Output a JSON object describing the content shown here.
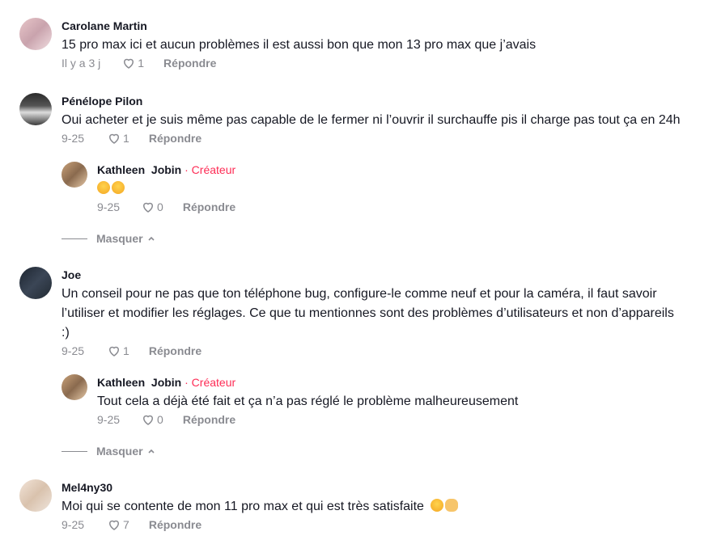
{
  "comments": [
    {
      "author": "Carolane Martin",
      "text": "15 pro max ici et aucun problèmes il est aussi bon que mon 13 pro max que j’avais",
      "date": "Il y a 3 j",
      "likes": "1",
      "reply": "Répondre"
    },
    {
      "author": "Pénélope Pilon",
      "text": "Oui acheter et je suis même pas capable de le fermer ni l’ouvrir il surchauffe pis il charge pas tout ça en 24h",
      "date": "9-25",
      "likes": "1",
      "reply": "Répondre",
      "replies": [
        {
          "author": "Kathleen  Jobin",
          "badge": "· Créateur",
          "text": "",
          "emojis": [
            "pleading-face",
            "pleading-face"
          ],
          "date": "9-25",
          "likes": "0",
          "reply": "Répondre"
        }
      ],
      "hide_label": "Masquer"
    },
    {
      "author": "Joe",
      "text_lines": [
        "Un conseil pour ne pas que ton téléphone bug, configure-le comme neuf et pour la caméra, il faut savoir",
        "l’utiliser et modifier les réglages. Ce que tu mentionnes sont des problèmes d’utilisateurs et non d’appareils",
        ":)"
      ],
      "date": "9-25",
      "likes": "1",
      "reply": "Répondre",
      "replies": [
        {
          "author": "Kathleen  Jobin",
          "badge": "· Créateur",
          "text": "Tout cela a déjà été fait et ça n’a pas réglé le problème malheureusement",
          "date": "9-25",
          "likes": "0",
          "reply": "Répondre"
        }
      ],
      "hide_label": "Masquer"
    },
    {
      "author": "Mel4ny30",
      "text": "Moi qui se contente de mon 11 pro max et qui est très satisfaite",
      "emojis": [
        "laughing-face",
        "ok-hand"
      ],
      "date": "9-25",
      "likes": "7",
      "reply": "Répondre"
    }
  ],
  "colors": {
    "text": "#161823",
    "muted": "#8a8b91",
    "creator": "#fe2c55"
  }
}
